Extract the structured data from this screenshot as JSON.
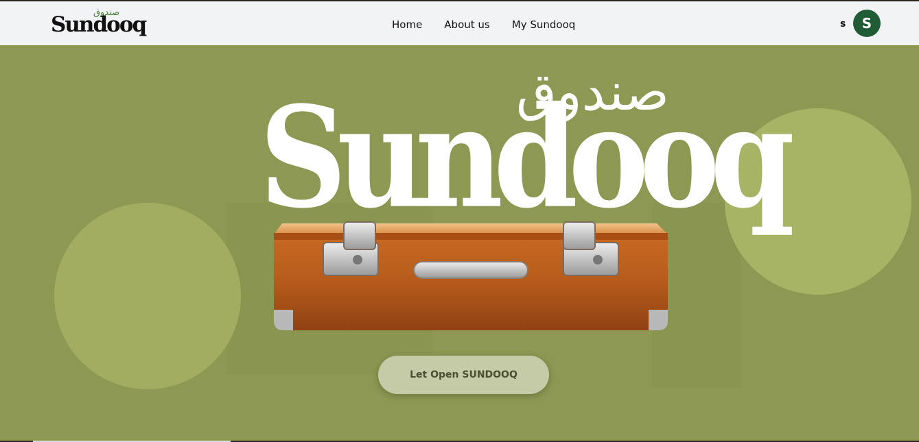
{
  "header": {
    "logo_text": "Sundooq",
    "logo_arabic": "صندوق",
    "nav": [
      {
        "label": "Home"
      },
      {
        "label": "About us"
      },
      {
        "label": "My Sundooq"
      }
    ],
    "user_name": "s",
    "avatar_initial": "S",
    "avatar_color": "#1f5c36"
  },
  "hero": {
    "brand_text": "Sundooq",
    "brand_arabic": "صندوق",
    "background_color": "#8d9852",
    "circle_color": "#a3ad62",
    "illustration": "suitcase-icon",
    "cta_label": "Let Open SUNDOOQ"
  }
}
